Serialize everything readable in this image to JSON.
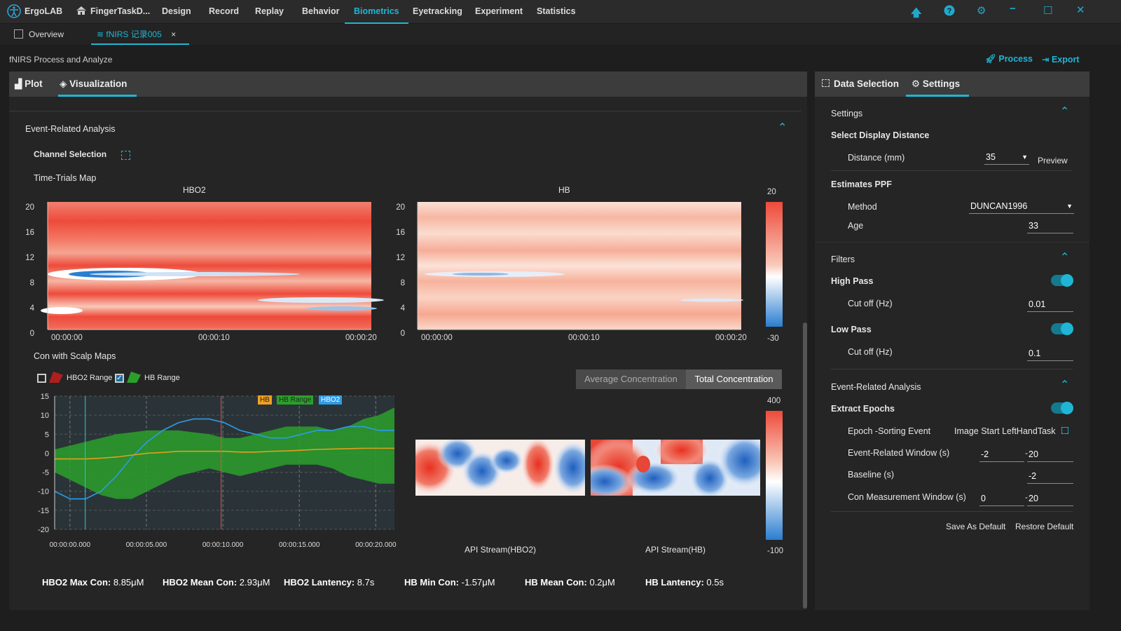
{
  "titlebar": {
    "app_name": "ErgoLAB",
    "project": "FingerTaskD...",
    "menu": [
      "Design",
      "Record",
      "Replay",
      "Behavior",
      "Biometrics",
      "Eyetracking",
      "Experiment",
      "Statistics"
    ],
    "active_menu": "Biometrics"
  },
  "doc_tabs": {
    "overview": "Overview",
    "active": "fNIRS 记录005"
  },
  "subheader": {
    "title": "fNIRS Process and Analyze",
    "process": "Process",
    "export": "Export"
  },
  "left_panel": {
    "tab_plot": "Plot",
    "tab_visualization": "Visualization",
    "event_section": "Event-Related Analysis",
    "channel_selection": "Channel Selection",
    "time_trials": "Time-Trials Map",
    "heat_hbo2_title": "HBO2",
    "heat_hb_title": "HB",
    "heat_yticks": [
      "20",
      "16",
      "12",
      "8",
      "4",
      "0"
    ],
    "heat_xticks": [
      "00:00:00",
      "00:00:10",
      "00:00:20"
    ],
    "colorbar1": {
      "max": "20",
      "min": "-30"
    },
    "scalp_section": "Con with Scalp Maps",
    "legend_hbo2_range": "HBO2 Range",
    "legend_hb_range": "HB Range",
    "btn_average": "Average Concentration",
    "btn_total": "Total Concentration",
    "line_legend": [
      "HB",
      "HB Range",
      "HBO2"
    ],
    "line_yticks": [
      "15",
      "10",
      "5",
      "0",
      "-5",
      "-10",
      "-15",
      "-20"
    ],
    "line_xticks": [
      "00:00:00.000",
      "00:00:05.000",
      "00:00:10.000",
      "00:00:15.000",
      "00:00:20.000"
    ],
    "map_hbo2_label": "API Stream(HBO2)",
    "map_hb_label": "API Stream(HB)",
    "colorbar2": {
      "max": "400",
      "min": "-100"
    },
    "stats": [
      {
        "label": "HBO2 Max Con:",
        "value": "8.85μM"
      },
      {
        "label": "HBO2 Mean Con:",
        "value": "2.93μM"
      },
      {
        "label": "HBO2 Lantency:",
        "value": "8.7s"
      },
      {
        "label": "HB Min Con:",
        "value": "-1.57μM"
      },
      {
        "label": "HB Mean Con:",
        "value": "0.2μM"
      },
      {
        "label": "HB Lantency:",
        "value": "0.5s"
      }
    ]
  },
  "chart_data": {
    "type": "line",
    "x": [
      0,
      1,
      2,
      3,
      4,
      5,
      6,
      7,
      8,
      9,
      10,
      11,
      12,
      13,
      14,
      15,
      16,
      17,
      18,
      19,
      20,
      21,
      22
    ],
    "xlabel": "",
    "ylabel": "",
    "ylim": [
      -20,
      15
    ],
    "series": [
      {
        "name": "HBO2",
        "color": "#2f9be8",
        "values": [
          -10,
          -12,
          -12,
          -10,
          -6,
          -1,
          3,
          6,
          8,
          9,
          9,
          8,
          6,
          5,
          4,
          4,
          5,
          6,
          6,
          7,
          7,
          6,
          6
        ]
      },
      {
        "name": "HB",
        "color": "#e0a020",
        "values": [
          -1.5,
          -1.5,
          -1.5,
          -1.3,
          -1.0,
          -0.5,
          0,
          0.2,
          0.5,
          0.5,
          0.5,
          0.5,
          0.3,
          0.3,
          0.5,
          0.6,
          0.8,
          1.0,
          1.1,
          1.2,
          1.3,
          1.3,
          1.3
        ]
      },
      {
        "name": "HB Range",
        "color": "#2aa02a",
        "upper": [
          1,
          2,
          3,
          4,
          5,
          5.5,
          6,
          6,
          6,
          5.5,
          5,
          4,
          4,
          5,
          6,
          7,
          7,
          7,
          6,
          7,
          9,
          10,
          12
        ],
        "lower": [
          -5,
          -7,
          -9,
          -11,
          -12,
          -12,
          -10,
          -8,
          -6,
          -5,
          -4,
          -5,
          -6,
          -5,
          -4,
          -3,
          -3,
          -3,
          -4,
          -6,
          -7,
          -8,
          -8
        ]
      }
    ]
  },
  "right_panel": {
    "tab_data": "Data Selection",
    "tab_settings": "Settings",
    "settings_title": "Settings",
    "display_distance": "Select Display Distance",
    "distance_label": "Distance (mm)",
    "distance_value": "35",
    "preview": "Preview",
    "estimates": "Estimates PPF",
    "method_label": "Method",
    "method_value": "DUNCAN1996",
    "age_label": "Age",
    "age_value": "33",
    "filters": "Filters",
    "high_pass": "High Pass",
    "hp_cut_label": "Cut off (Hz)",
    "hp_cut_value": "0.01",
    "low_pass": "Low Pass",
    "lp_cut_label": "Cut off (Hz)",
    "lp_cut_value": "0.1",
    "era_title": "Event-Related Analysis",
    "extract_epochs": "Extract Epochs",
    "epoch_label": "Epoch -Sorting Event",
    "epoch_value": "Image Start LeftHandTask",
    "window_label": "Event-Related Window (s)",
    "window_from": "-2",
    "window_to": "20",
    "baseline_label": "Baseline (s)",
    "baseline_value": "-2",
    "con_window_label": "Con Measurement Window (s)",
    "con_from": "0",
    "con_to": "20",
    "save_default": "Save As Default",
    "restore_default": "Restore Default"
  }
}
